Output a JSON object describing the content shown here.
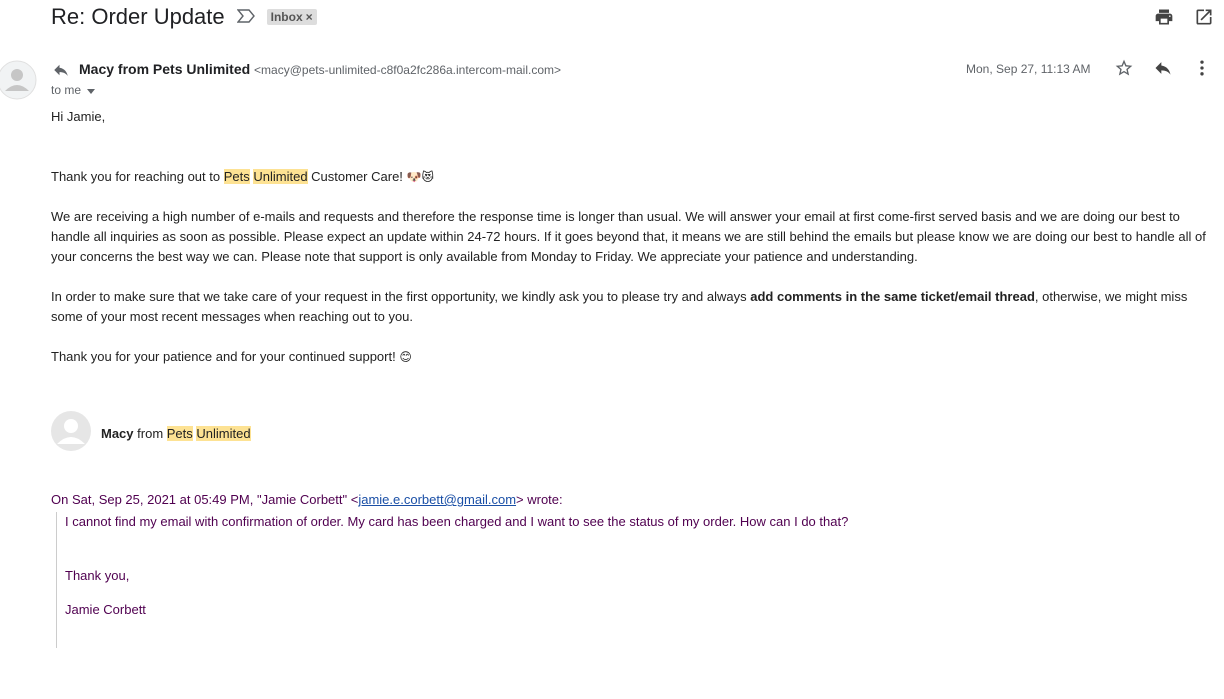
{
  "subject": "Re: Order Update",
  "labels": [
    {
      "name": "Inbox",
      "remove_glyph": "×"
    }
  ],
  "top_actions": [
    {
      "icon": "print-icon"
    },
    {
      "icon": "open-in-new-window-icon"
    }
  ],
  "message": {
    "sender_name": "Macy from Pets Unlimited",
    "sender_email": "<macy@pets-unlimited-c8f0a2fc286a.intercom-mail.com>",
    "recipient": "to me",
    "date": "Mon, Sep 27, 11:13 AM",
    "actions": [
      {
        "icon": "star-icon"
      },
      {
        "icon": "reply-icon"
      },
      {
        "icon": "more-vert-icon"
      }
    ],
    "body": {
      "greeting": "Hi Jamie,",
      "thanks_pre": "Thank you for reaching out to ",
      "brand_1": "Pets",
      "brand_2": "Unlimited",
      "thanks_post": " Customer Care! ",
      "thanks_emoji": "🐶😻",
      "para_delay": "We are receiving a high number of e-mails and requests and therefore the response time is longer than usual. We will answer your email at first come-first served basis and we are doing our best to handle all inquiries as soon as possible. Please expect an update within 24-72 hours. If it goes beyond that, it means we are still behind the emails but please know we are doing our best to handle all of your concerns the best way we can. Please note that support is only available from Monday to Friday. We appreciate your patience and understanding.",
      "para_order_pre": "In order to make sure that we take care of your request in the first opportunity, we kindly ask you to please try and always ",
      "para_order_bold": "add comments in the same ticket/email thread",
      "para_order_post": ", otherwise, we might miss some of your most recent messages when reaching out to you.",
      "closing": "Thank you for your patience and for your continued support! ",
      "closing_emoji": "😊"
    },
    "signature": {
      "name": "Macy",
      "from": " from ",
      "brand_1": "Pets",
      "brand_2": "Unlimited"
    },
    "quoted": {
      "header_pre": "On Sat, Sep 25, 2021 at 05:49 PM, \"Jamie Corbett\" <",
      "header_email": "jamie.e.corbett@gmail.com",
      "header_post": "> wrote:",
      "text": "I cannot find my email with confirmation of order. My card has been charged and I want to see the status of my order. How can I do that?",
      "thanks": "Thank you,",
      "name": "Jamie Corbett"
    }
  },
  "colors": {
    "highlight": "#fde293",
    "quote_text": "#500050",
    "link": "#1a4fa6",
    "icon": "#5f6368"
  }
}
